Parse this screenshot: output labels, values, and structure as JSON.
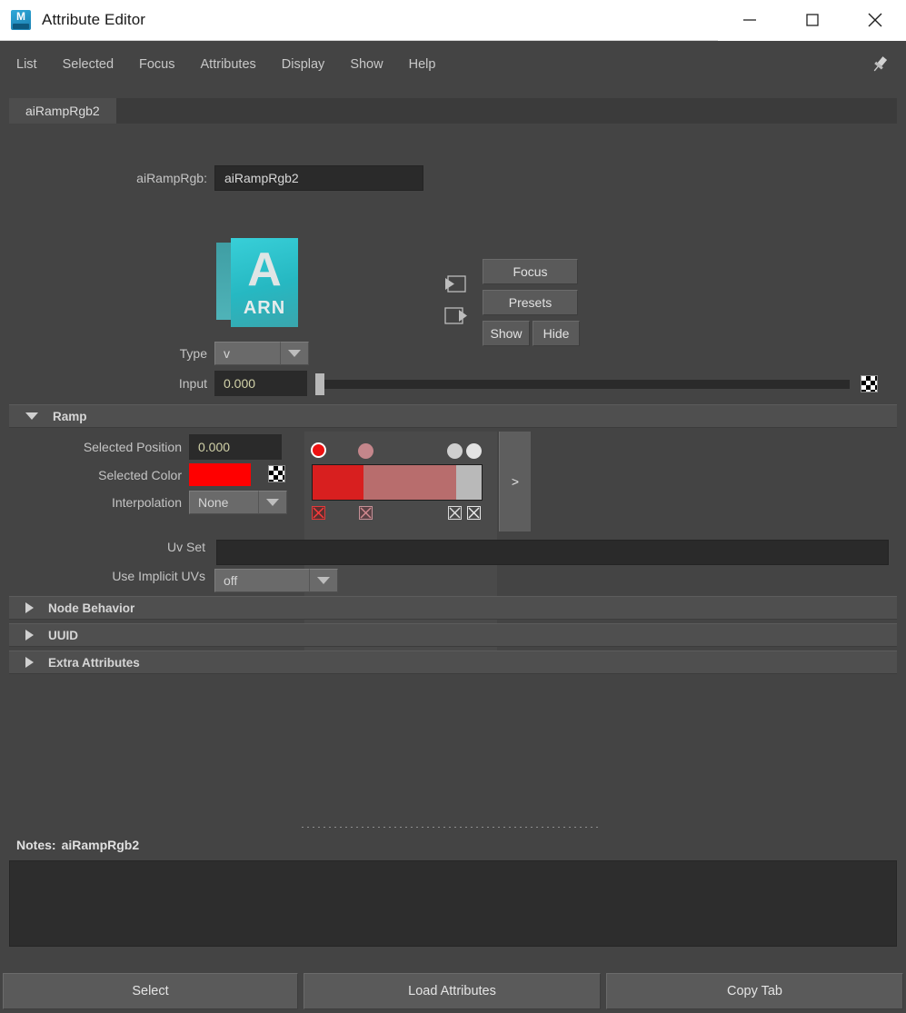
{
  "window": {
    "title": "Attribute Editor",
    "app_icon": "maya-logo-icon",
    "minimize_label": "Minimize",
    "maximize_label": "Maximize",
    "close_label": "Close"
  },
  "menubar": {
    "items": [
      {
        "label": "List"
      },
      {
        "label": "Selected"
      },
      {
        "label": "Focus"
      },
      {
        "label": "Attributes"
      },
      {
        "label": "Display"
      },
      {
        "label": "Show"
      },
      {
        "label": "Help"
      }
    ],
    "pin_icon": "pin-icon"
  },
  "tabs": [
    {
      "label": "aiRampRgb2",
      "active": true
    }
  ],
  "node": {
    "type_label": "aiRampRgb:",
    "name_value": "aiRampRgb2",
    "input_conn_icon": "input-connection-icon",
    "output_conn_icon": "output-connection-icon",
    "focus_button": "Focus",
    "presets_button": "Presets",
    "show_button": "Show",
    "hide_button": "Hide",
    "icon_letter": "A",
    "icon_caption": "ARN"
  },
  "attributes": {
    "type": {
      "label": "Type",
      "value": "v"
    },
    "input": {
      "label": "Input",
      "value": "0.000",
      "slider_position_pct": 0,
      "map_button_icon": "checker-map-icon"
    }
  },
  "ramp_section": {
    "title": "Ramp",
    "expanded": true,
    "selected_position": {
      "label": "Selected Position",
      "value": "0.000"
    },
    "selected_color": {
      "label": "Selected Color",
      "value": "#ff0000",
      "map_button_icon": "checker-map-icon"
    },
    "interpolation": {
      "label": "Interpolation",
      "value": "None"
    },
    "expand_button": ">",
    "ramp": {
      "bands": [
        {
          "color": "#d81f1f",
          "start_pct": 0,
          "end_pct": 30
        },
        {
          "color": "#b86d6d",
          "start_pct": 30,
          "end_pct": 85
        },
        {
          "color": "#b9b9b9",
          "start_pct": 85,
          "end_pct": 100
        }
      ],
      "markers": [
        {
          "color": "#ee1111",
          "pos_pct": 3,
          "selected": true
        },
        {
          "color": "#c4868b",
          "pos_pct": 31,
          "selected": false
        },
        {
          "color": "#cfcfcf",
          "pos_pct": 84,
          "selected": false
        },
        {
          "color": "#e2e2e2",
          "pos_pct": 95,
          "selected": false
        }
      ]
    }
  },
  "uv": {
    "uv_set": {
      "label": "Uv Set",
      "value": ""
    },
    "use_implicit_uvs": {
      "label": "Use Implicit UVs",
      "value": "off"
    }
  },
  "collapsed_sections": [
    {
      "title": "Node Behavior"
    },
    {
      "title": "UUID"
    },
    {
      "title": "Extra Attributes"
    }
  ],
  "notes": {
    "label": "Notes:",
    "value": "aiRampRgb2",
    "content": ""
  },
  "bottom_buttons": [
    {
      "label": "Select"
    },
    {
      "label": "Load Attributes"
    },
    {
      "label": "Copy Tab"
    }
  ]
}
